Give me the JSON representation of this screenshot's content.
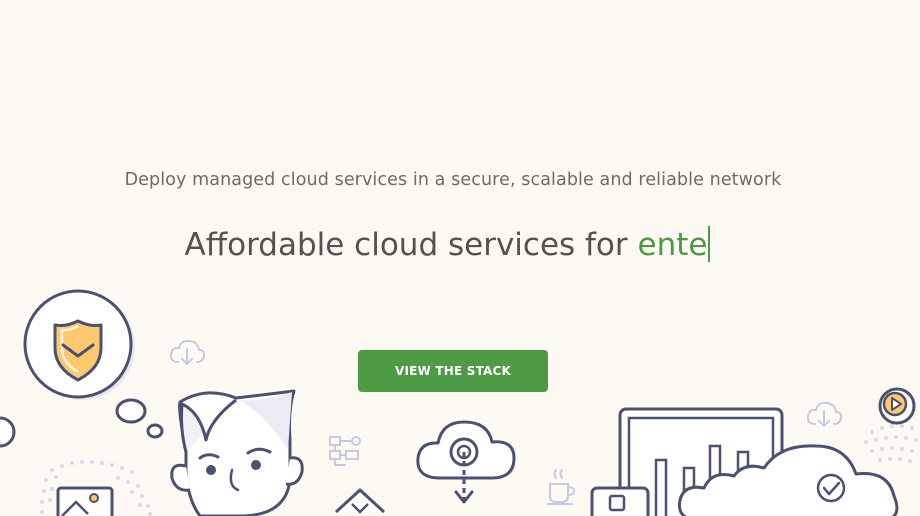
{
  "hero": {
    "subtitle": "Deploy managed cloud services in a secure, scalable and reliable network",
    "headline_static": "Affordable cloud services for ",
    "headline_typed": "ente",
    "cta_label": "VIEW THE STACK"
  },
  "colors": {
    "background": "#fdfaf4",
    "accent_green": "#4f9a45",
    "line_art": "#4b5270",
    "highlight_orange": "#fcc970"
  },
  "icons": [
    "shield-icon",
    "cloud-download-icon",
    "flowchart-icon",
    "cloud-upload-icon",
    "coffee-cup-icon",
    "play-button-icon",
    "bar-chart-monitor-icon",
    "checkmark-icon",
    "image-icon"
  ]
}
